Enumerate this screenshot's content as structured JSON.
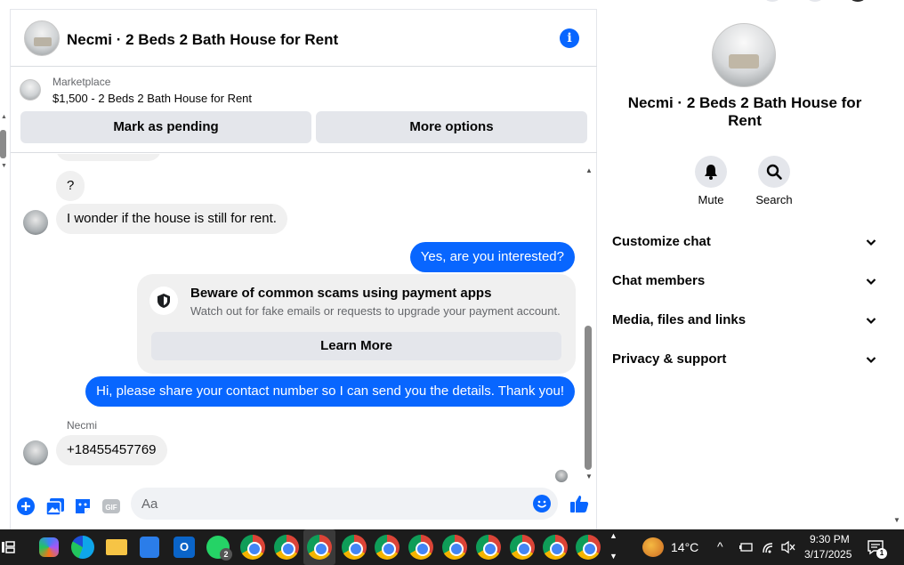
{
  "header": {
    "title": "Necmi · 2 Beds 2 Bath House for Rent"
  },
  "marketplace": {
    "label": "Marketplace",
    "item": "$1,500 - 2 Beds 2 Bath House for Rent",
    "pending_label": "Mark as pending",
    "more_label": "More options"
  },
  "messages": [
    {
      "from": "them",
      "text": "?"
    },
    {
      "from": "them",
      "text": "I wonder if the house is still for rent."
    },
    {
      "from": "me",
      "text": "Yes, are you interested?"
    },
    {
      "from": "me",
      "text": "Hi, please share your contact number so I can send you the details. Thank you!"
    },
    {
      "from": "them",
      "sender": "Necmi",
      "text": "+18455457769"
    }
  ],
  "scam_notice": {
    "title": "Beware of common scams using payment apps",
    "description": "Watch out for fake emails or requests to upgrade your payment account.",
    "button": "Learn More"
  },
  "composer": {
    "placeholder": "Aa"
  },
  "side_panel": {
    "title": "Necmi · 2 Beds 2 Bath House for Rent",
    "actions": [
      {
        "label": "Mute",
        "icon": "bell-icon"
      },
      {
        "label": "Search",
        "icon": "search-icon"
      }
    ],
    "sections": [
      {
        "label": "Customize chat"
      },
      {
        "label": "Chat members"
      },
      {
        "label": "Media, files and links"
      },
      {
        "label": "Privacy & support"
      }
    ]
  },
  "taskbar": {
    "whatsapp_badge": "2",
    "weather": "14°C",
    "time": "9:30 PM",
    "date": "3/17/2025",
    "notifications": "1"
  },
  "colors": {
    "accent": "#0866ff",
    "bubble_in": "#f0f0f0",
    "button_bg": "#e4e6eb"
  }
}
